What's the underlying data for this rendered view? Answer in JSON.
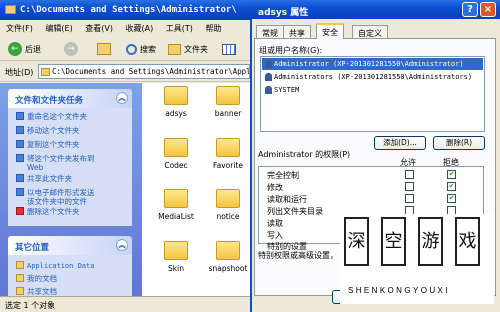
{
  "explorer": {
    "title": "C:\\Documents and Settings\\Administrator\\",
    "menu": [
      "文件(F)",
      "编辑(E)",
      "查看(V)",
      "收藏(A)",
      "工具(T)",
      "帮助"
    ],
    "toolbar": {
      "back": "后退",
      "search": "搜索",
      "folders": "文件夹"
    },
    "address_label": "地址(D)",
    "address_value": "C:\\Documents and Settings\\Administrator\\Appli",
    "tasks_panel": {
      "title": "文件和文件夹任务",
      "items": [
        "重命名这个文件夹",
        "移动这个文件夹",
        "复制这个文件夹",
        "将这个文件夹发布到",
        "Web",
        "共享此文件夹",
        "以电子邮件形式发送",
        "该文件夹中的文件",
        "删除这个文件夹"
      ]
    },
    "places_panel": {
      "title": "其它位置",
      "items": [
        "Application Data",
        "我的文档",
        "共享文档"
      ]
    },
    "files": [
      "adsys",
      "banner",
      "Codec",
      "Favorite",
      "MediaList",
      "notice",
      "Skin",
      "snapshoot"
    ],
    "status": "选定 1 个对象"
  },
  "dialog": {
    "title": "adsys 属性",
    "tabs": [
      "常规",
      "共享",
      "安全",
      "自定义"
    ],
    "active_tab": "安全",
    "groups_label": "组或用户名称(G):",
    "users": [
      "Administrator (XP-201301281550\\Administrator)",
      "Administrators (XP-201301281550\\Administrators)",
      "SYSTEM"
    ],
    "add_button": "添加(D)...",
    "remove_button": "删除(R)",
    "permissions_label": "Administrator 的权限(P)",
    "allow_label": "允许",
    "deny_label": "拒绝",
    "permissions": [
      {
        "name": "完全控制",
        "allow": false,
        "deny": true
      },
      {
        "name": "修改",
        "allow": false,
        "deny": true
      },
      {
        "name": "读取和运行",
        "allow": false,
        "deny": true
      },
      {
        "name": "列出文件夹目录",
        "allow": false,
        "deny": false
      },
      {
        "name": "读取",
        "allow": false,
        "deny": false
      },
      {
        "name": "写入",
        "allow": false,
        "deny": false
      },
      {
        "name": "特别的设置",
        "allow": false,
        "deny": false
      }
    ],
    "advanced_text": "特别权限或高级设置，"
  },
  "watermark": {
    "chars": [
      "深",
      "空",
      "游",
      "戏"
    ],
    "letters": "SHENKONGYOUXI"
  },
  "colors": {
    "accent": "#0a4fd0",
    "task_link": "#215dc6",
    "selection": "#316ac5",
    "check": "#21a121"
  }
}
